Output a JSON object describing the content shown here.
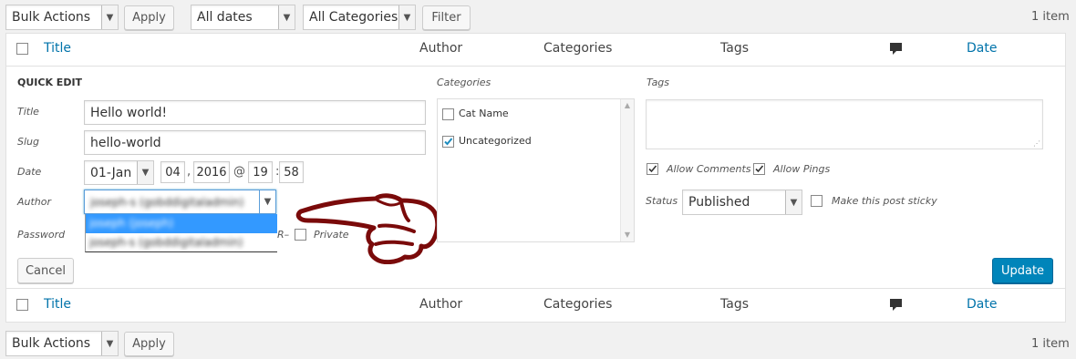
{
  "top_bar": {
    "bulk_actions": "Bulk Actions",
    "apply": "Apply",
    "dates": "All dates",
    "categories": "All Categories",
    "filter": "Filter",
    "count": "1 item"
  },
  "header": {
    "title": "Title",
    "author": "Author",
    "categories": "Categories",
    "tags": "Tags",
    "date": "Date"
  },
  "quick_edit": {
    "heading": "QUICK EDIT",
    "title_label": "Title",
    "title_value": "Hello world!",
    "slug_label": "Slug",
    "slug_value": "hello-world",
    "date_label": "Date",
    "month": "01-Jan",
    "day": "04",
    "year": "2016",
    "at": "@",
    "hour": "19",
    "minute": "58",
    "comma": ",",
    "colon": ":",
    "author_label": "Author",
    "author_value": "joseph-s (gobddigitaladmin)",
    "author_options": [
      "joseph (joseph)",
      "joseph-s (gobddigitaladmin)"
    ],
    "password_label": "Password",
    "password_trail": "R–",
    "private_label": "Private",
    "categories_label": "Categories",
    "category_items": [
      {
        "label": "Cat Name",
        "checked": false
      },
      {
        "label": "Uncategorized",
        "checked": true
      }
    ],
    "tags_label": "Tags",
    "allow_comments": "Allow Comments",
    "allow_pings": "Allow Pings",
    "status_label": "Status",
    "status_value": "Published",
    "sticky_label": "Make this post sticky",
    "cancel": "Cancel",
    "update": "Update"
  },
  "bottom_bar": {
    "bulk_actions": "Bulk Actions",
    "apply": "Apply",
    "count": "1 item"
  },
  "colors": {
    "link": "#0073aa",
    "primary": "#0085ba",
    "highlight": "#3399ff",
    "hand": "#7a0a0a"
  },
  "icons": [
    "chevron-down-icon",
    "comment-bubble-icon",
    "checkmark-icon",
    "resize-grip-icon",
    "pointing-hand-icon"
  ]
}
